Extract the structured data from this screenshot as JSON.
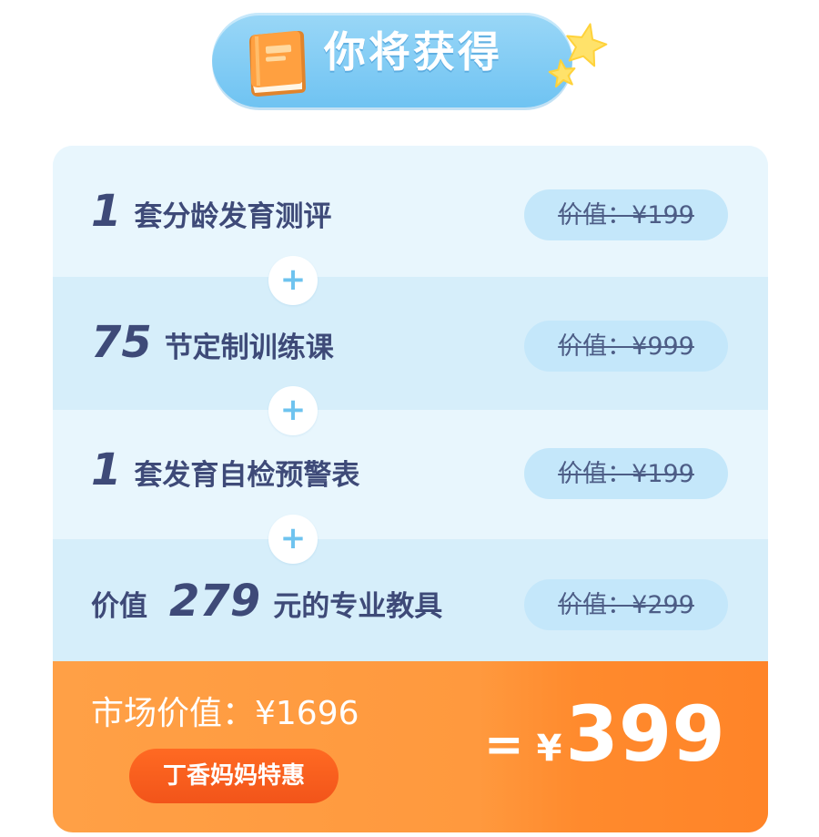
{
  "header": {
    "title": "你将获得",
    "icons": [
      "book-icon",
      "star-icon"
    ]
  },
  "items": [
    {
      "prefix": "",
      "number": "1",
      "label": " 套分龄发育测评",
      "value": "价值：¥199"
    },
    {
      "prefix": "",
      "number": "75",
      "label": " 节定制训练课",
      "value": "价值：¥999"
    },
    {
      "prefix": "",
      "number": "1",
      "label": " 套发育自检预警表",
      "value": "价值：¥199"
    },
    {
      "prefix": "价值",
      "number": "279",
      "label": " 元的专业教具",
      "value": "价值：¥299"
    }
  ],
  "plus_symbol": "+",
  "summary": {
    "market_value": "市场价值：¥1696",
    "promo_badge": "丁香妈妈特惠",
    "equals": "=",
    "currency": "¥",
    "final_price": "399"
  },
  "colors": {
    "header_pill": "#6fc3f2",
    "band_light": "#e8f6fd",
    "band_dark": "#d6eefa",
    "text_primary": "#3e4a78",
    "value_pill": "#c4e7fa",
    "plus": "#6ec3ef",
    "bottom_orange": "#ff9438",
    "promo_red": "#f2541a"
  }
}
